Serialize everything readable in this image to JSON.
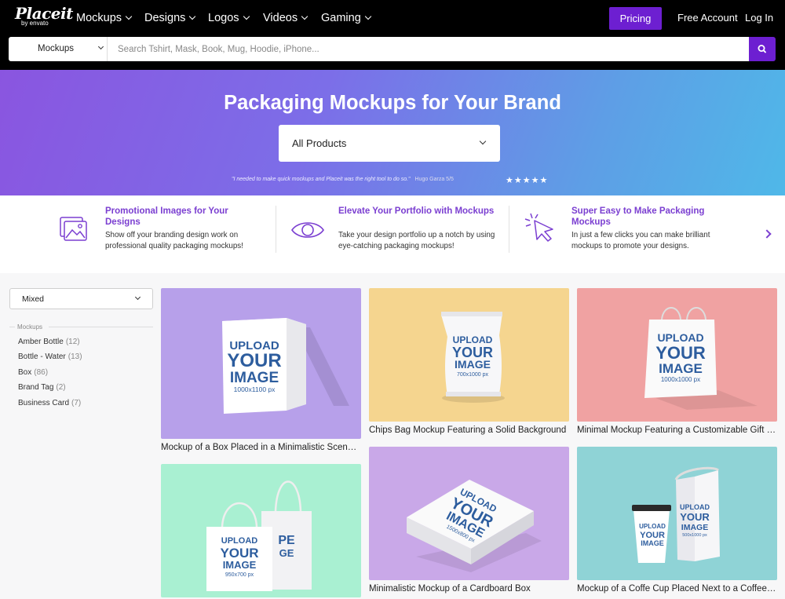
{
  "nav": {
    "logo": "Placeit",
    "logo_sub": "by envato",
    "items": [
      "Mockups",
      "Designs",
      "Logos",
      "Videos",
      "Gaming"
    ],
    "pricing": "Pricing",
    "free_account": "Free Account",
    "login": "Log In"
  },
  "search": {
    "category": "Mockups",
    "placeholder": "Search Tshirt, Mask, Book, Mug, Hoodie, iPhone..."
  },
  "hero": {
    "title": "Packaging Mockups for Your Brand",
    "select_value": "All Products",
    "testimonial": "\"I needed to make quick mockups and Placeit was the right tool to do so.\"",
    "author": "Hugo Garza 5/5",
    "stars": "★★★★★"
  },
  "features": [
    {
      "title": "Promotional Images for Your Designs",
      "desc": "Show off your branding design work on professional quality packaging mockups!",
      "icon": "images-icon"
    },
    {
      "title": "Elevate Your Portfolio with Mockups",
      "desc": "Take your design portfolio up a notch by using eye-catching packaging mockups!",
      "icon": "eye-icon"
    },
    {
      "title": "Super Easy to Make Packaging Mockups",
      "desc": "In just a few clicks you can make brilliant mockups to promote your designs.",
      "icon": "cursor-click-icon"
    }
  ],
  "sidebar": {
    "sort_value": "Mixed",
    "filter_heading": "Mockups",
    "filters": [
      {
        "label": "Amber Bottle",
        "count": "(12)"
      },
      {
        "label": "Bottle - Water",
        "count": "(13)"
      },
      {
        "label": "Box",
        "count": "(86)"
      },
      {
        "label": "Brand Tag",
        "count": "(2)"
      },
      {
        "label": "Business Card",
        "count": "(7)"
      }
    ]
  },
  "cards": [
    {
      "title": "Mockup of a Box Placed in a Minimalistic Scenario",
      "bg": "#b7a0ea",
      "upload": "UPLOAD",
      "your": "YOUR",
      "image": "IMAGE",
      "dims": "1000x1100 px"
    },
    {
      "title": "Chips Bag Mockup Featuring a Solid Background",
      "bg": "#f5d58f",
      "upload": "UPLOAD",
      "your": "YOUR",
      "image": "IMAGE",
      "dims": "700x1000 px"
    },
    {
      "title": "Minimal Mockup Featuring a Customizable Gift Bag",
      "bg": "#f0a2a2",
      "upload": "UPLOAD",
      "your": "YOUR",
      "image": "IMAGE",
      "dims": "1000x1000 px"
    },
    {
      "title": "",
      "bg": "#a9f0d2",
      "upload": "UPLOAD",
      "your": "YOUR",
      "image": "IMAGE",
      "dims": "950x700 px"
    },
    {
      "title": "Minimalistic Mockup of a Cardboard Box",
      "bg": "#c9a8e8",
      "upload": "UPLOAD",
      "your": "YOUR",
      "image": "IMAGE",
      "dims": "1500x800 px"
    },
    {
      "title": "Mockup of a Coffe Cup Placed Next to a Coffee Bag",
      "bg": "#8fd3d6",
      "upload": "UPLOAD",
      "your": "YOUR",
      "image": "IMAGE",
      "dims": "500x1000 px"
    }
  ]
}
